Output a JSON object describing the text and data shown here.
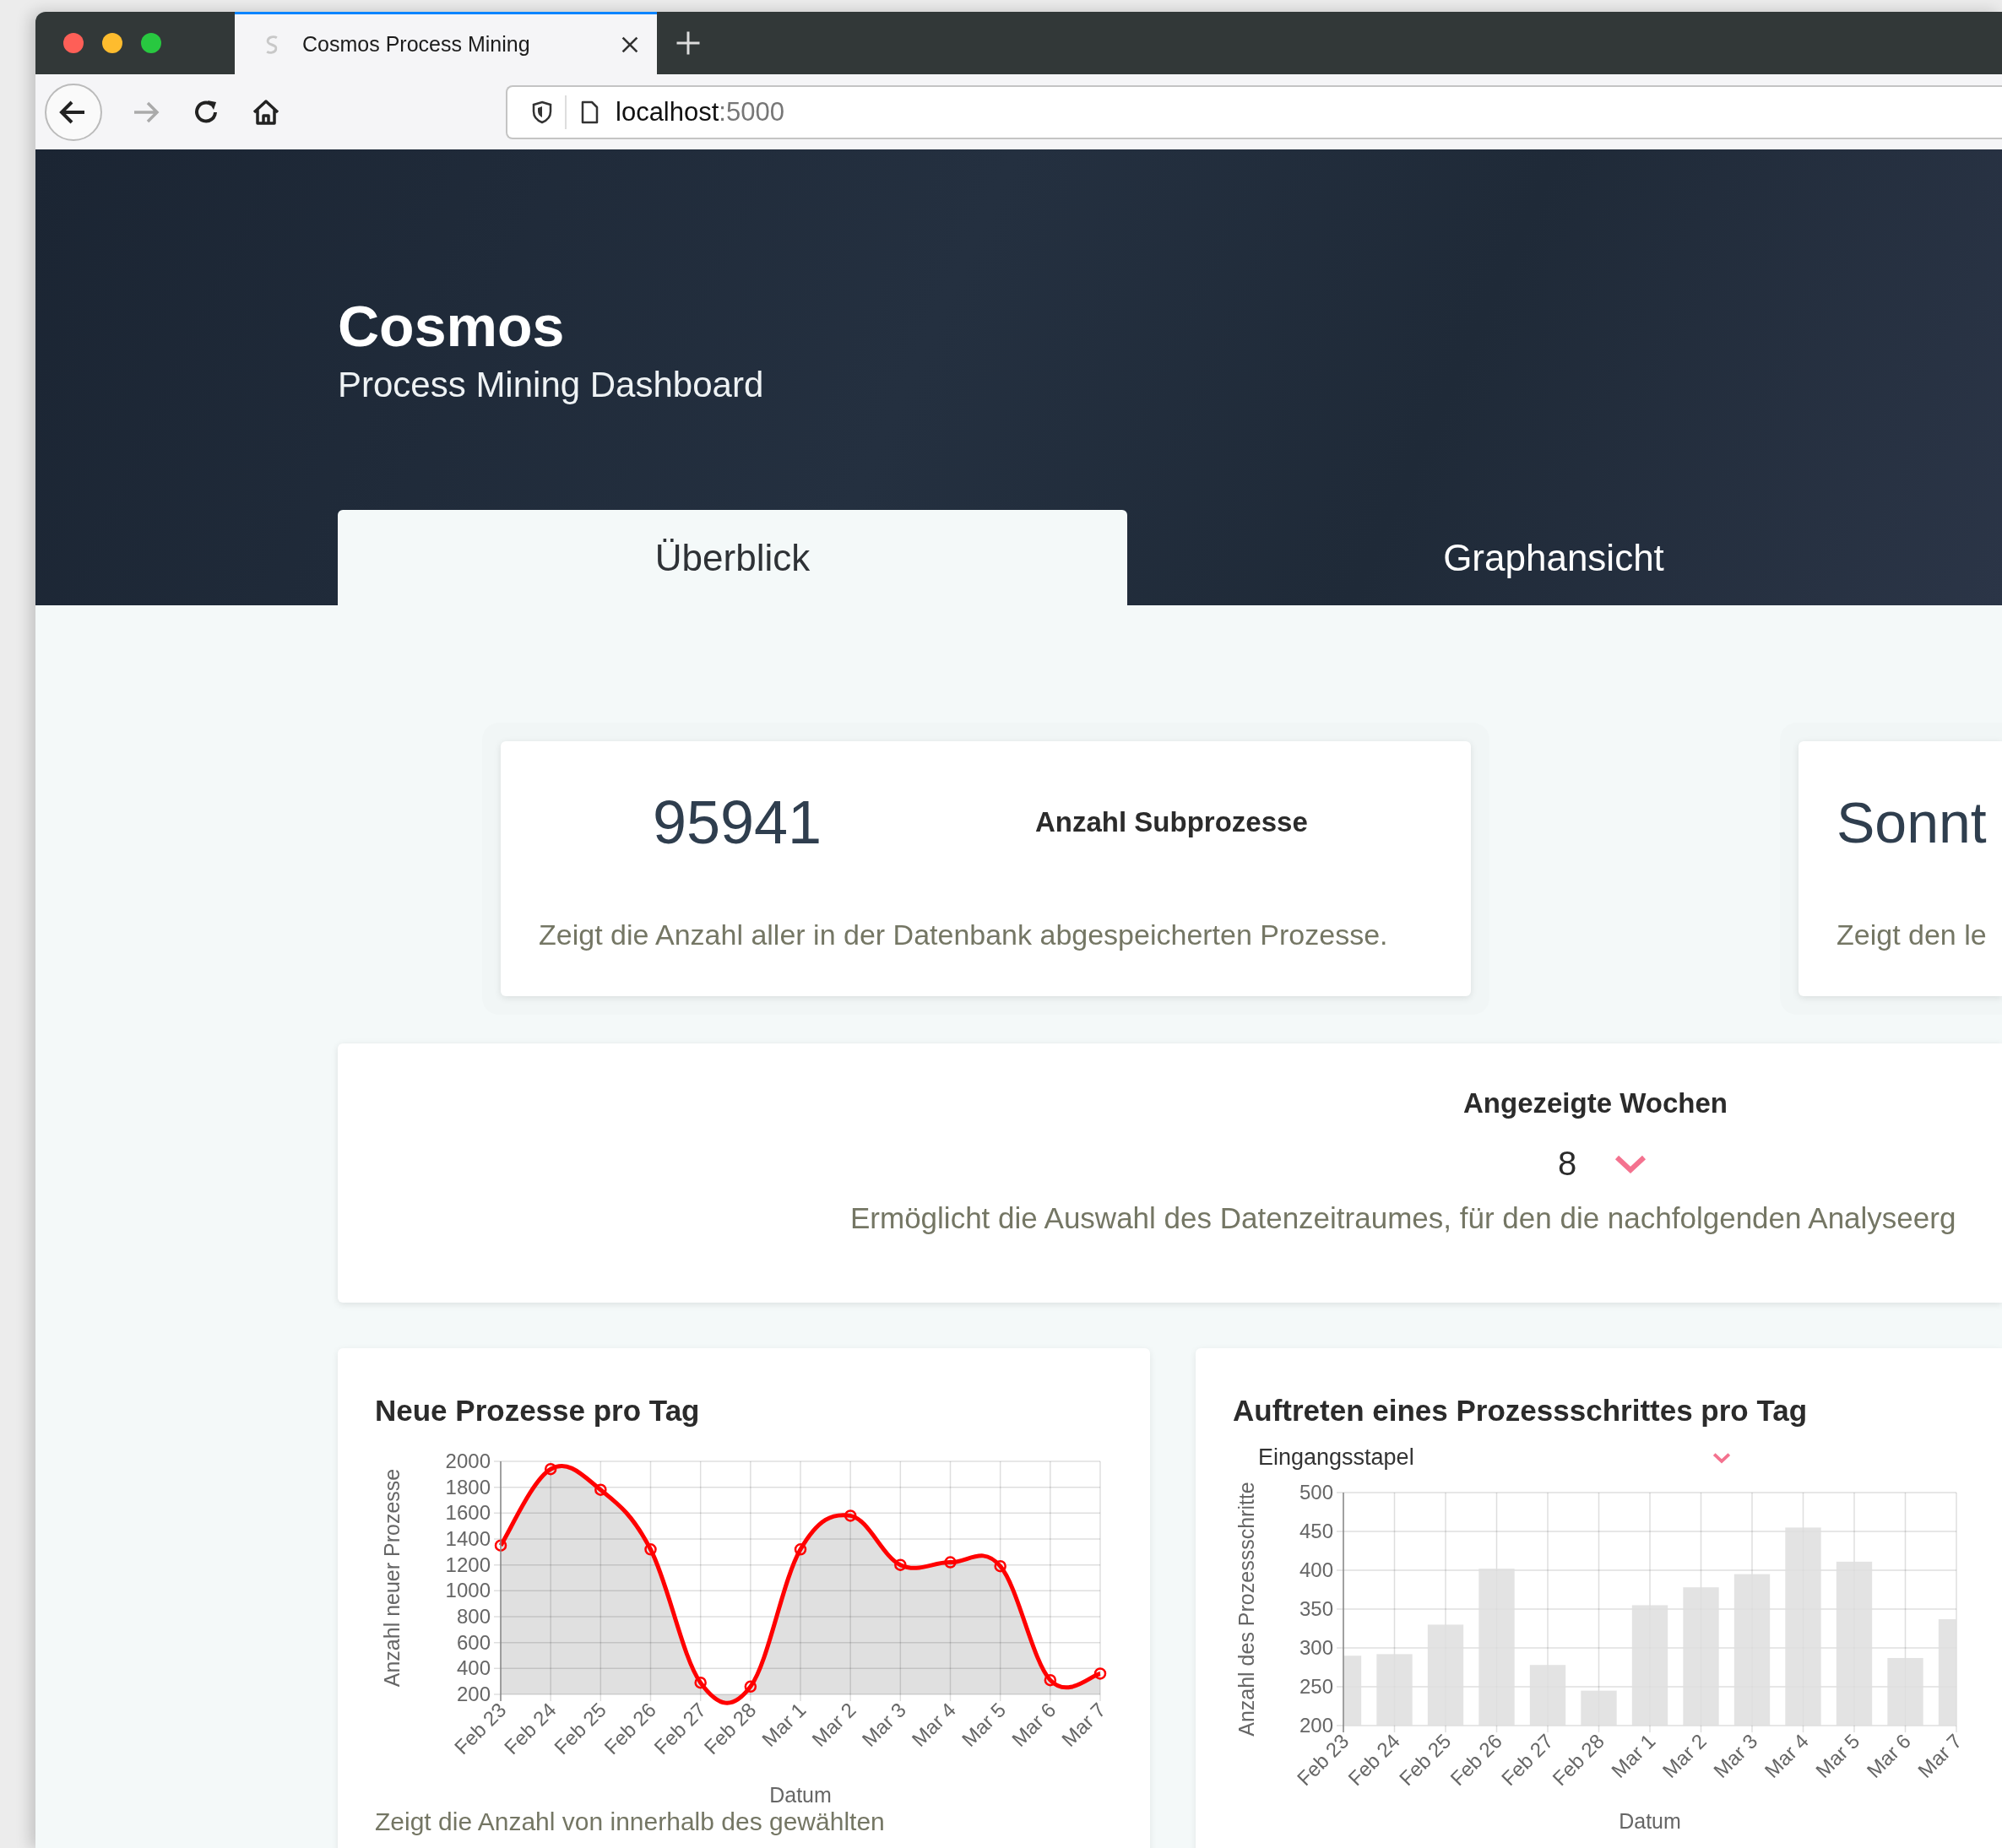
{
  "browser": {
    "tab": {
      "title": "Cosmos Process Mining",
      "selected": true
    },
    "url": {
      "host": "localhost",
      "port": ":5000"
    }
  },
  "header": {
    "title": "Cosmos",
    "subtitle": "Process Mining Dashboard"
  },
  "nav_tabs": [
    {
      "label": "Überblick",
      "selected": true
    },
    {
      "label": "Graphansicht",
      "selected": false
    }
  ],
  "stat_cards": [
    {
      "value": "95941",
      "label": "Anzahl Subprozesse",
      "description": "Zeigt die Anzahl aller in der Datenbank abgespeicherten Prozesse."
    },
    {
      "value": "Sonnt",
      "description": "Zeigt den le"
    }
  ],
  "weeks_filter": {
    "label": "Angezeigte Wochen",
    "value": "8",
    "description": "Ermöglicht die Auswahl des Datenzeitraumes, für den die nachfolgenden Analyseerg"
  },
  "charts": [
    {
      "title": "Neue Prozesse pro Tag",
      "chart_data": {
        "type": "area",
        "xlabel": "Datum",
        "ylabel": "Anzahl neuer Prozesse",
        "categories": [
          "Feb 23",
          "Feb 24",
          "Feb 25",
          "Feb 26",
          "Feb 27",
          "Feb 28",
          "Mar 1",
          "Mar 2",
          "Mar 3",
          "Mar 4",
          "Mar 5",
          "Mar 6",
          "Mar 7"
        ],
        "series": [
          {
            "color": "#ff0000",
            "values": [
              1350,
              1940,
              1780,
              1320,
              290,
              260,
              1320,
              1580,
              1200,
              1220,
              1190,
              310,
              360
            ]
          }
        ],
        "ylim": [
          200,
          2000
        ],
        "grid": true,
        "yticks": [
          200,
          400,
          600,
          800,
          1000,
          1200,
          1400,
          1600,
          1800,
          2000
        ]
      },
      "description": "Zeigt die Anzahl von innerhalb des gewählten"
    },
    {
      "title": "Auftreten eines Prozessschrittes pro Tag",
      "selector": "Eingangsstapel",
      "chart_data": {
        "type": "bar",
        "xlabel": "Datum",
        "ylabel": "Anzahl des Prozessschritte",
        "categories": [
          "Feb 23",
          "Feb 24",
          "Feb 25",
          "Feb 26",
          "Feb 27",
          "Feb 28",
          "Mar 1",
          "Mar 2",
          "Mar 3",
          "Mar 4",
          "Mar 5",
          "Mar 6",
          "Mar 7"
        ],
        "series": [
          {
            "color": "#dedede",
            "values": [
              290,
              292,
              330,
              402,
              278,
              245,
              355,
              378,
              395,
              455,
              411,
              287,
              337
            ]
          }
        ],
        "ylim": [
          200,
          500
        ],
        "grid": true,
        "yticks": [
          200,
          250,
          300,
          350,
          400,
          450,
          500
        ]
      }
    }
  ]
}
